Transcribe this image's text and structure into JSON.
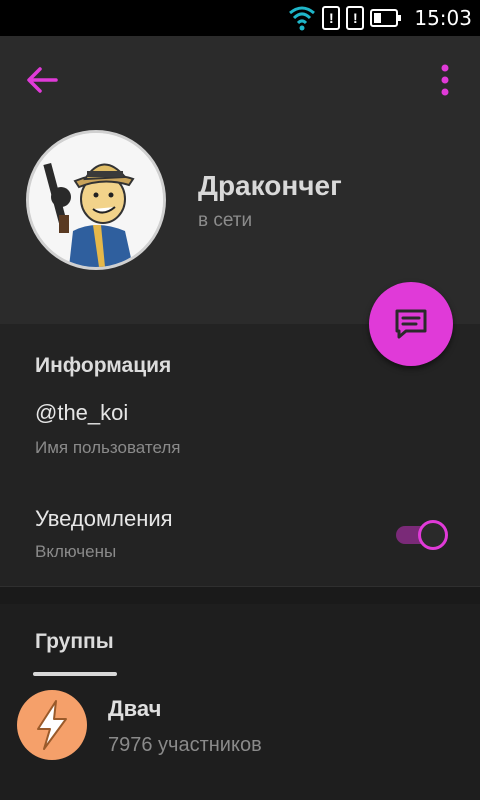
{
  "status_bar": {
    "time": "15:03",
    "alert_glyph": "!",
    "icons": [
      "wifi-icon",
      "alert-icon",
      "alert-icon",
      "battery-icon"
    ]
  },
  "header": {
    "back_icon": "arrow-left-icon",
    "menu_icon": "more-vertical-icon",
    "accent_color": "#e03ad8"
  },
  "profile": {
    "name": "Дракончег",
    "status": "в сети"
  },
  "fab": {
    "icon": "chat-bubble-icon"
  },
  "info": {
    "title": "Информация",
    "username": "@the_koi",
    "username_label": "Имя пользователя",
    "notifications_label": "Уведомления",
    "notifications_value": "Включены",
    "notifications_enabled": true
  },
  "groups": {
    "title": "Группы",
    "items": [
      {
        "name": "Двач",
        "members": "7976 участников",
        "icon": "lightning-icon",
        "color": "#f5a06a"
      }
    ]
  }
}
